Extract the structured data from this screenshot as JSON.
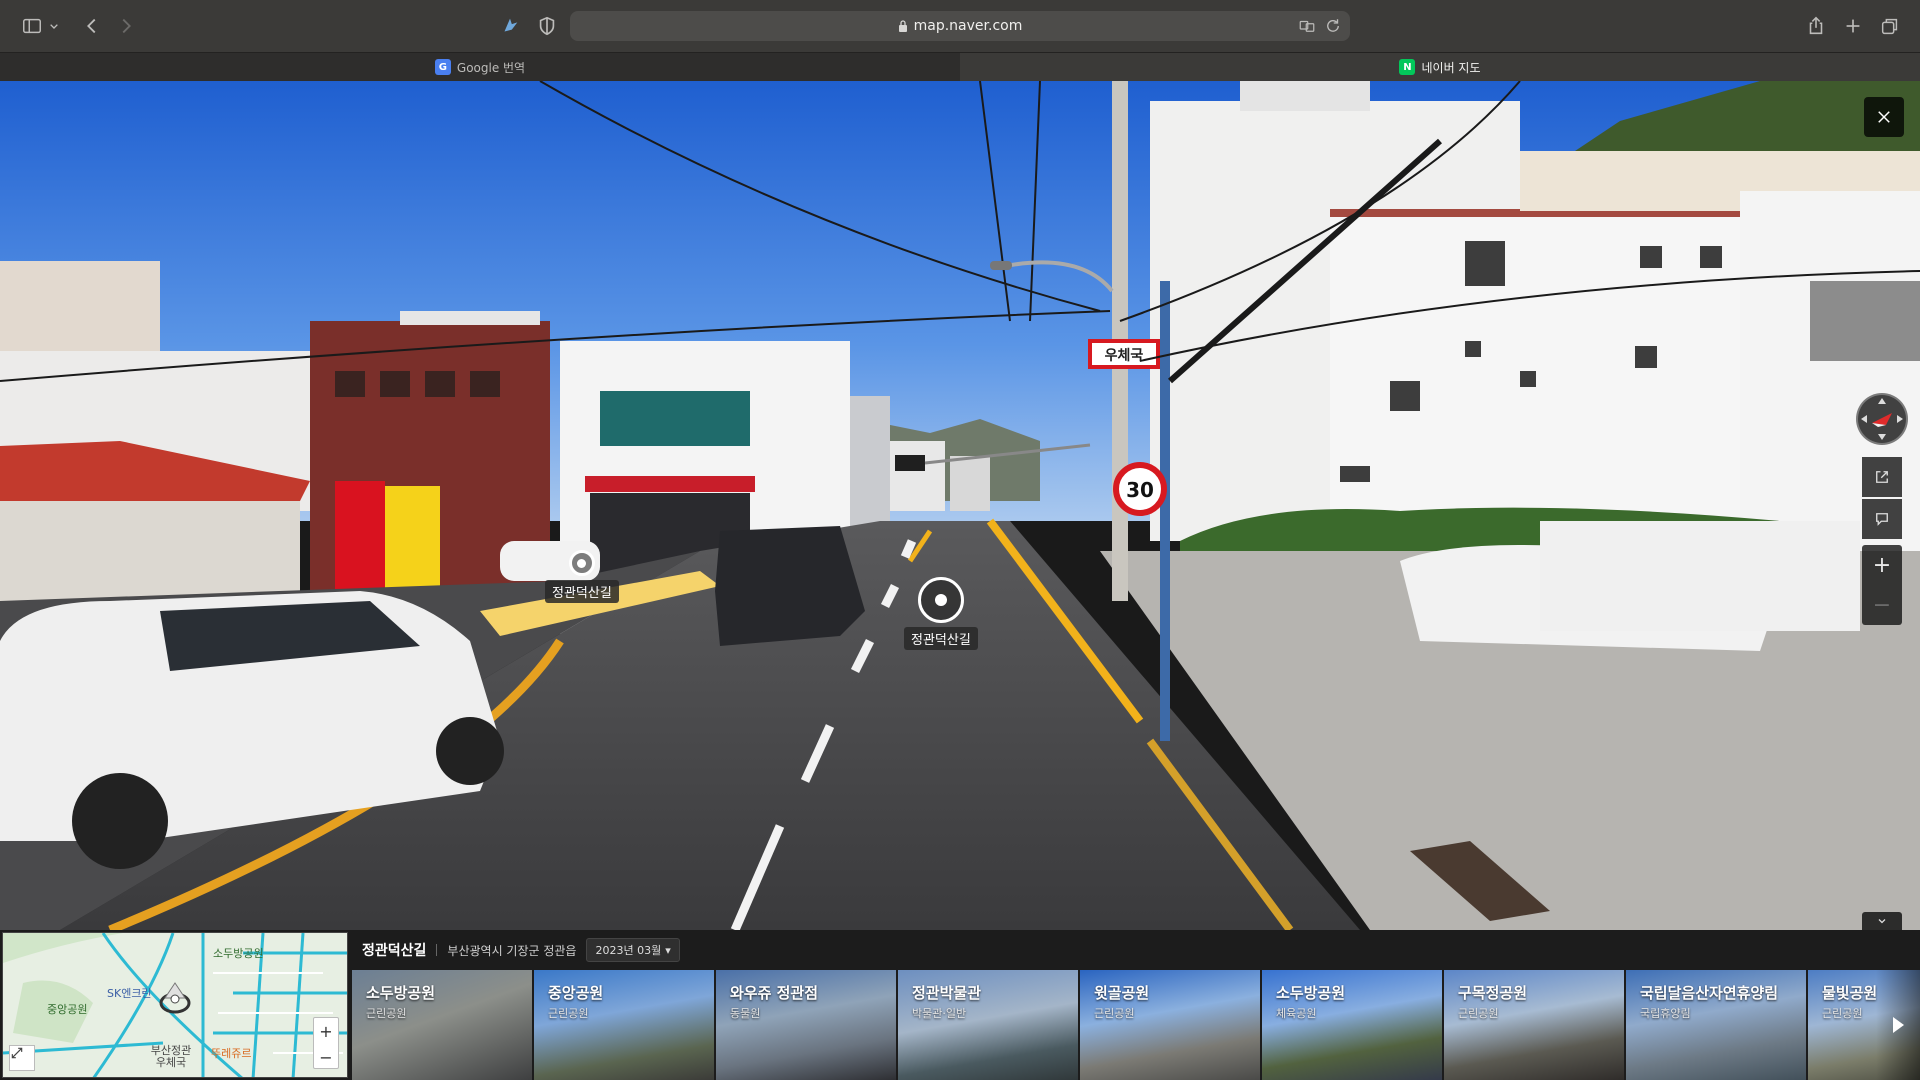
{
  "browser": {
    "url": "map.naver.com",
    "tabs": [
      {
        "label": "Google 번역",
        "favicon_text": "G",
        "favicon_color": "#4a7ff0",
        "active": false
      },
      {
        "label": "네이버 지도",
        "favicon_text": "N",
        "favicon_color": "#03c75a",
        "active": true
      }
    ]
  },
  "panorama": {
    "markers": [
      {
        "label": "정관덕산길"
      },
      {
        "label": "정관덕산길"
      }
    ],
    "signs": {
      "post_office": "우체국",
      "speed_limit": "30"
    }
  },
  "minimap": {
    "labels": {
      "park_top": "소두방공원",
      "park_left": "중앙공원",
      "sk": "SK엔크린",
      "post": "부산정관 우체국",
      "bakery": "뚜레쥬르"
    },
    "zoom_in": "+",
    "zoom_out": "−"
  },
  "info": {
    "place": "정관덕산길",
    "address": "부산광역시 기장군 정관읍",
    "date": "2023년 03월"
  },
  "thumbnails": [
    {
      "name": "소두방공원",
      "category": "근린공원"
    },
    {
      "name": "중앙공원",
      "category": "근린공원"
    },
    {
      "name": "와우쥬 정관점",
      "category": "동물원"
    },
    {
      "name": "정관박물관",
      "category": "박물관·일반"
    },
    {
      "name": "윗골공원",
      "category": "근린공원"
    },
    {
      "name": "소두방공원",
      "category": "체육공원"
    },
    {
      "name": "구목정공원",
      "category": "근린공원"
    },
    {
      "name": "국립달음산자연휴양림",
      "category": "국립휴양림"
    },
    {
      "name": "물빛공원",
      "category": "근린공원"
    }
  ]
}
